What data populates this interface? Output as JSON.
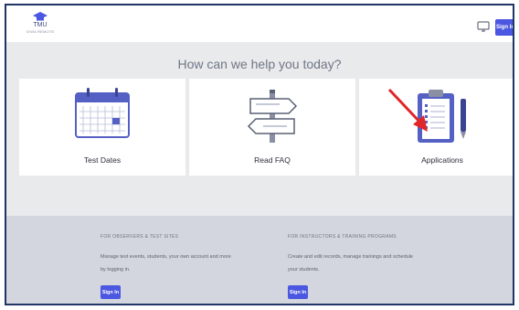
{
  "header": {
    "logo_name": "TMU",
    "logo_sub": "IOWA REMOTE",
    "signin_label": "Sign In"
  },
  "hero": {
    "title": "How can we help you today?",
    "cards": [
      {
        "label": "Test Dates",
        "icon": "calendar-icon"
      },
      {
        "label": "Read FAQ",
        "icon": "signpost-icon"
      },
      {
        "label": "Applications",
        "icon": "clipboard-icon"
      }
    ]
  },
  "sections": [
    {
      "heading": "FOR OBSERVERS & TEST SITES",
      "text_line1": "Manage test events, students, your own account and more",
      "text_line2": "by logging in.",
      "button": "Sign In"
    },
    {
      "heading": "FOR INSTRUCTORS & TRAINING PROGRAMS",
      "text_line1": "Create and edit records, manage trainings and schedule",
      "text_line2": "your students.",
      "button": "Sign In"
    }
  ],
  "colors": {
    "accent": "#4b57e0",
    "annotation": "#e0262a",
    "icon_blue": "#5460c4"
  }
}
